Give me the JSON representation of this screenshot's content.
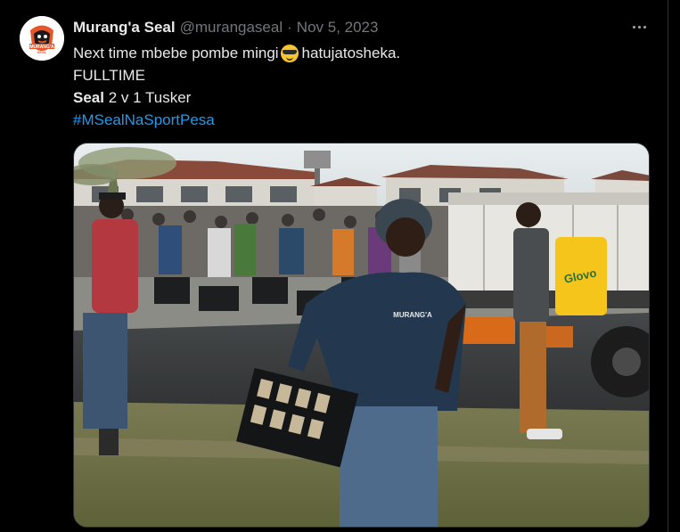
{
  "tweet": {
    "display_name": "Murang'a Seal",
    "handle": "@murangaseal",
    "separator": "·",
    "date": "Nov 5, 2023",
    "text_line1_before": "Next time mbebe pombe mingi",
    "emoji": "smiling-face-with-sunglasses",
    "text_line1_after": "hatujatosheka.",
    "text_line2": "FULLTIME",
    "score_team": "Seal",
    "score_rest": "2 v 1 Tusker",
    "hashtag": "#MSealNaSportPesa"
  },
  "avatar": {
    "logo_text": "MURANG'A",
    "logo_subtext": "SEAL"
  },
  "media": {
    "alt": "Man running with a crate of beer bottles near an overturned truck, crowd collecting spilled crates",
    "bag_text": "Glovo",
    "shirt_text": "MURANG'A"
  },
  "colors": {
    "background": "#000000",
    "text": "#e7e9ea",
    "muted": "#71767b",
    "link": "#1d9bf0",
    "border": "#2f3336"
  }
}
